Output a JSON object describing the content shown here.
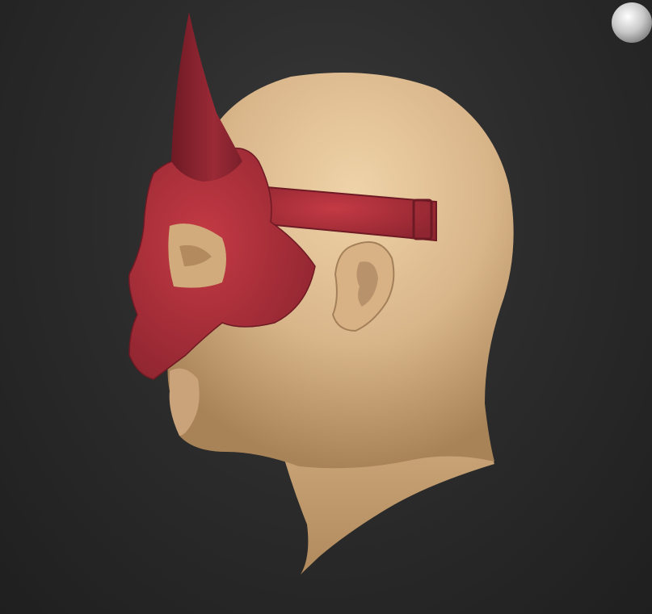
{
  "viewport": {
    "background": "#2a2a2a"
  },
  "model": {
    "skin_color": "#d6b48a",
    "skin_shadow": "#a88458",
    "mask_color": "#b8323c",
    "mask_dark": "#7e1f28",
    "horn_color": "#8c2330"
  },
  "navigation_widget": {
    "icon": "sphere-icon",
    "color": "#c8c8c8"
  }
}
